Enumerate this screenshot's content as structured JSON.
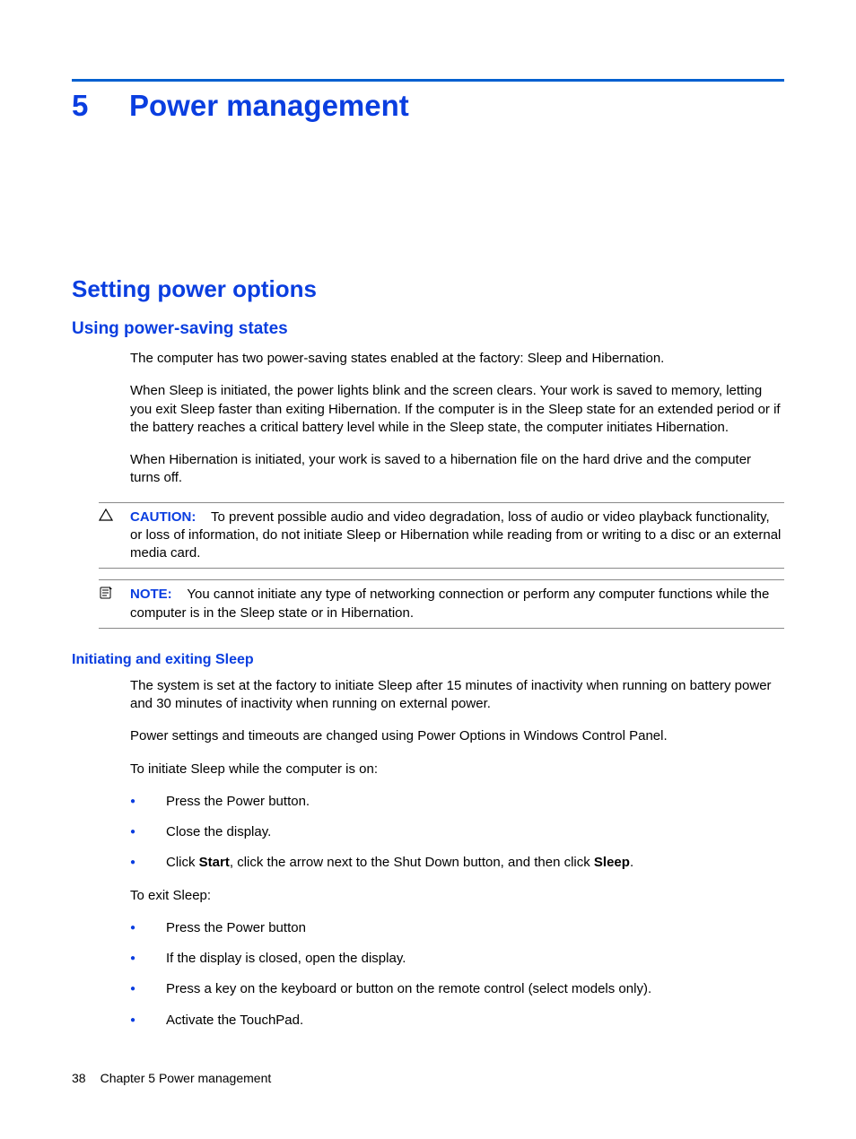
{
  "chapter": {
    "number": "5",
    "title": "Power management"
  },
  "section": "Setting power options",
  "subsection": "Using power-saving states",
  "paras": {
    "p1": "The computer has two power-saving states enabled at the factory: Sleep and Hibernation.",
    "p2": "When Sleep is initiated, the power lights blink and the screen clears. Your work is saved to memory, letting you exit Sleep faster than exiting Hibernation. If the computer is in the Sleep state for an extended period or if the battery reaches a critical battery level while in the Sleep state, the computer initiates Hibernation.",
    "p3": "When Hibernation is initiated, your work is saved to a hibernation file on the hard drive and the computer turns off."
  },
  "caution": {
    "label": "CAUTION:",
    "text": "To prevent possible audio and video degradation, loss of audio or video playback functionality, or loss of information, do not initiate Sleep or Hibernation while reading from or writing to a disc or an external media card."
  },
  "note": {
    "label": "NOTE:",
    "text": "You cannot initiate any type of networking connection or perform any computer functions while the computer is in the Sleep state or in Hibernation."
  },
  "subsub": "Initiating and exiting Sleep",
  "sleep": {
    "p1": "The system is set at the factory to initiate Sleep after 15 minutes of inactivity when running on battery power and 30 minutes of inactivity when running on external power.",
    "p2": "Power settings and timeouts are changed using Power Options in Windows Control Panel.",
    "p3": "To initiate Sleep while the computer is on:",
    "initiate": [
      "Press the Power button.",
      "Close the display."
    ],
    "initiate3_pre": "Click ",
    "initiate3_b1": "Start",
    "initiate3_mid": ", click the arrow next to the Shut Down button, and then click ",
    "initiate3_b2": "Sleep",
    "initiate3_post": ".",
    "p4": "To exit Sleep:",
    "exit": [
      "Press the Power button",
      "If the display is closed, open the display.",
      "Press a key on the keyboard or button on the remote control (select models only).",
      "Activate the TouchPad."
    ]
  },
  "footer": {
    "page": "38",
    "text": "Chapter 5   Power management"
  }
}
